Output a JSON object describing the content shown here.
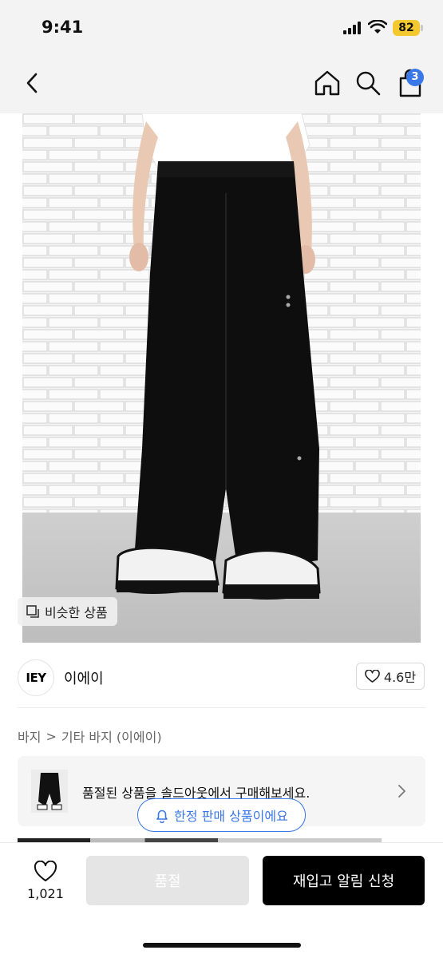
{
  "status_bar": {
    "time": "9:41",
    "battery": "82"
  },
  "nav": {
    "cart_count": "3"
  },
  "product_image": {
    "similar_label": "비슷한 상품"
  },
  "brand": {
    "logo_text": "IEY",
    "name": "이에이",
    "likes": "4.6만"
  },
  "breadcrumb": {
    "category": "바지",
    "separator": ">",
    "subcategory": "기타 바지 (이에이)"
  },
  "soldout_notice": {
    "text": "품절된 상품을 솔드아웃에서 구매해보세요."
  },
  "limited_pill": {
    "label": "한정 판매 상품이에요"
  },
  "bottom_bar": {
    "wish_count": "1,021",
    "soldout_label": "품절",
    "restock_label": "재입고 알림 신청"
  },
  "colors": {
    "accent": "#3a77e8",
    "primary_button": "#000000",
    "disabled_button": "#e5e5e5",
    "battery": "#f4c92f"
  },
  "icons": [
    "back-icon",
    "home-icon",
    "search-icon",
    "cart-icon",
    "similar-icon",
    "heart-icon",
    "chevron-right-icon",
    "bell-icon"
  ]
}
